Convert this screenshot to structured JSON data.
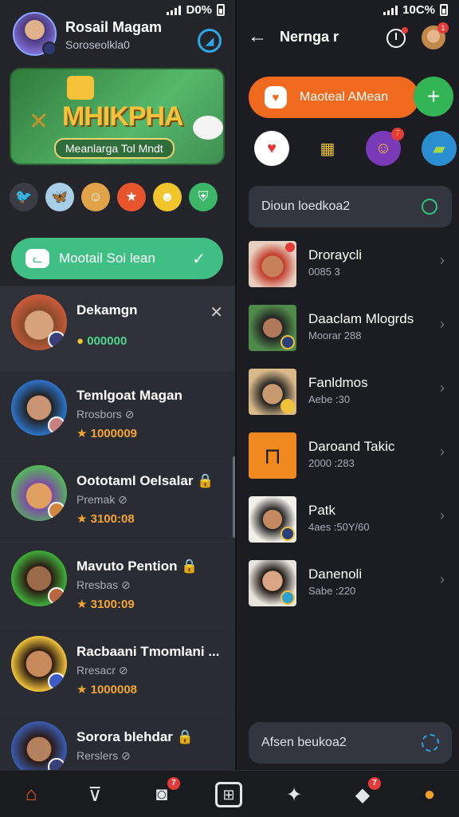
{
  "left": {
    "status": {
      "battery": "D0%"
    },
    "profile": {
      "name": "Rosail Magam",
      "subtitle": "Soroseolkla0"
    },
    "banner": {
      "title": "MHIKPHA",
      "pill": "Meanlarga Tol Mndt"
    },
    "action_button": {
      "label": "Mootail Soi lean"
    },
    "list": [
      {
        "name": "Dekamgn",
        "subtitle": "",
        "value": "000000",
        "value_color": "green",
        "closable": true
      },
      {
        "name": "Temlgoat Magan",
        "subtitle": "Rrosbors",
        "value": "1000009",
        "closable": false
      },
      {
        "name": "Oototaml Oelsalar",
        "subtitle": "Premak",
        "value": "3100:08",
        "closable": false
      },
      {
        "name": "Mavuto Pention",
        "subtitle": "Rresbas",
        "value": "3100:09",
        "closable": false
      },
      {
        "name": "Racbaani Tmomlani ...",
        "subtitle": "Rresacr",
        "value": "1000008",
        "closable": false
      },
      {
        "name": "Sorora blehdar",
        "subtitle": "Rerslers",
        "value": "",
        "closable": false
      }
    ]
  },
  "right": {
    "status": {
      "battery": "10C%"
    },
    "header": {
      "title": "Nernga r"
    },
    "notify_badge": "1",
    "action_button": {
      "label": "Maoteal AMean"
    },
    "icon_badge": "7",
    "search": {
      "placeholder": "Dioun loedkoa2"
    },
    "list": [
      {
        "name": "Droraycli",
        "subtitle": "0085 3"
      },
      {
        "name": "Daaclam Mlogrds",
        "subtitle": "Moorar 288"
      },
      {
        "name": "Fanldmos",
        "subtitle": "Aebe :30"
      },
      {
        "name": "Daroand Takic",
        "subtitle": "2000 :283"
      },
      {
        "name": "Patk",
        "subtitle": "4aes :50Y/60"
      },
      {
        "name": "Danenoli",
        "subtitle": "Sabe :220"
      }
    ],
    "bottom_search": {
      "placeholder": "Afsen beukoa2"
    }
  },
  "nav": {
    "badge_1": "7",
    "badge_2": "7"
  },
  "colors": {
    "accent_green": "#3fbf84",
    "accent_orange": "#ef6a1f",
    "badge_red": "#e53a3a"
  }
}
